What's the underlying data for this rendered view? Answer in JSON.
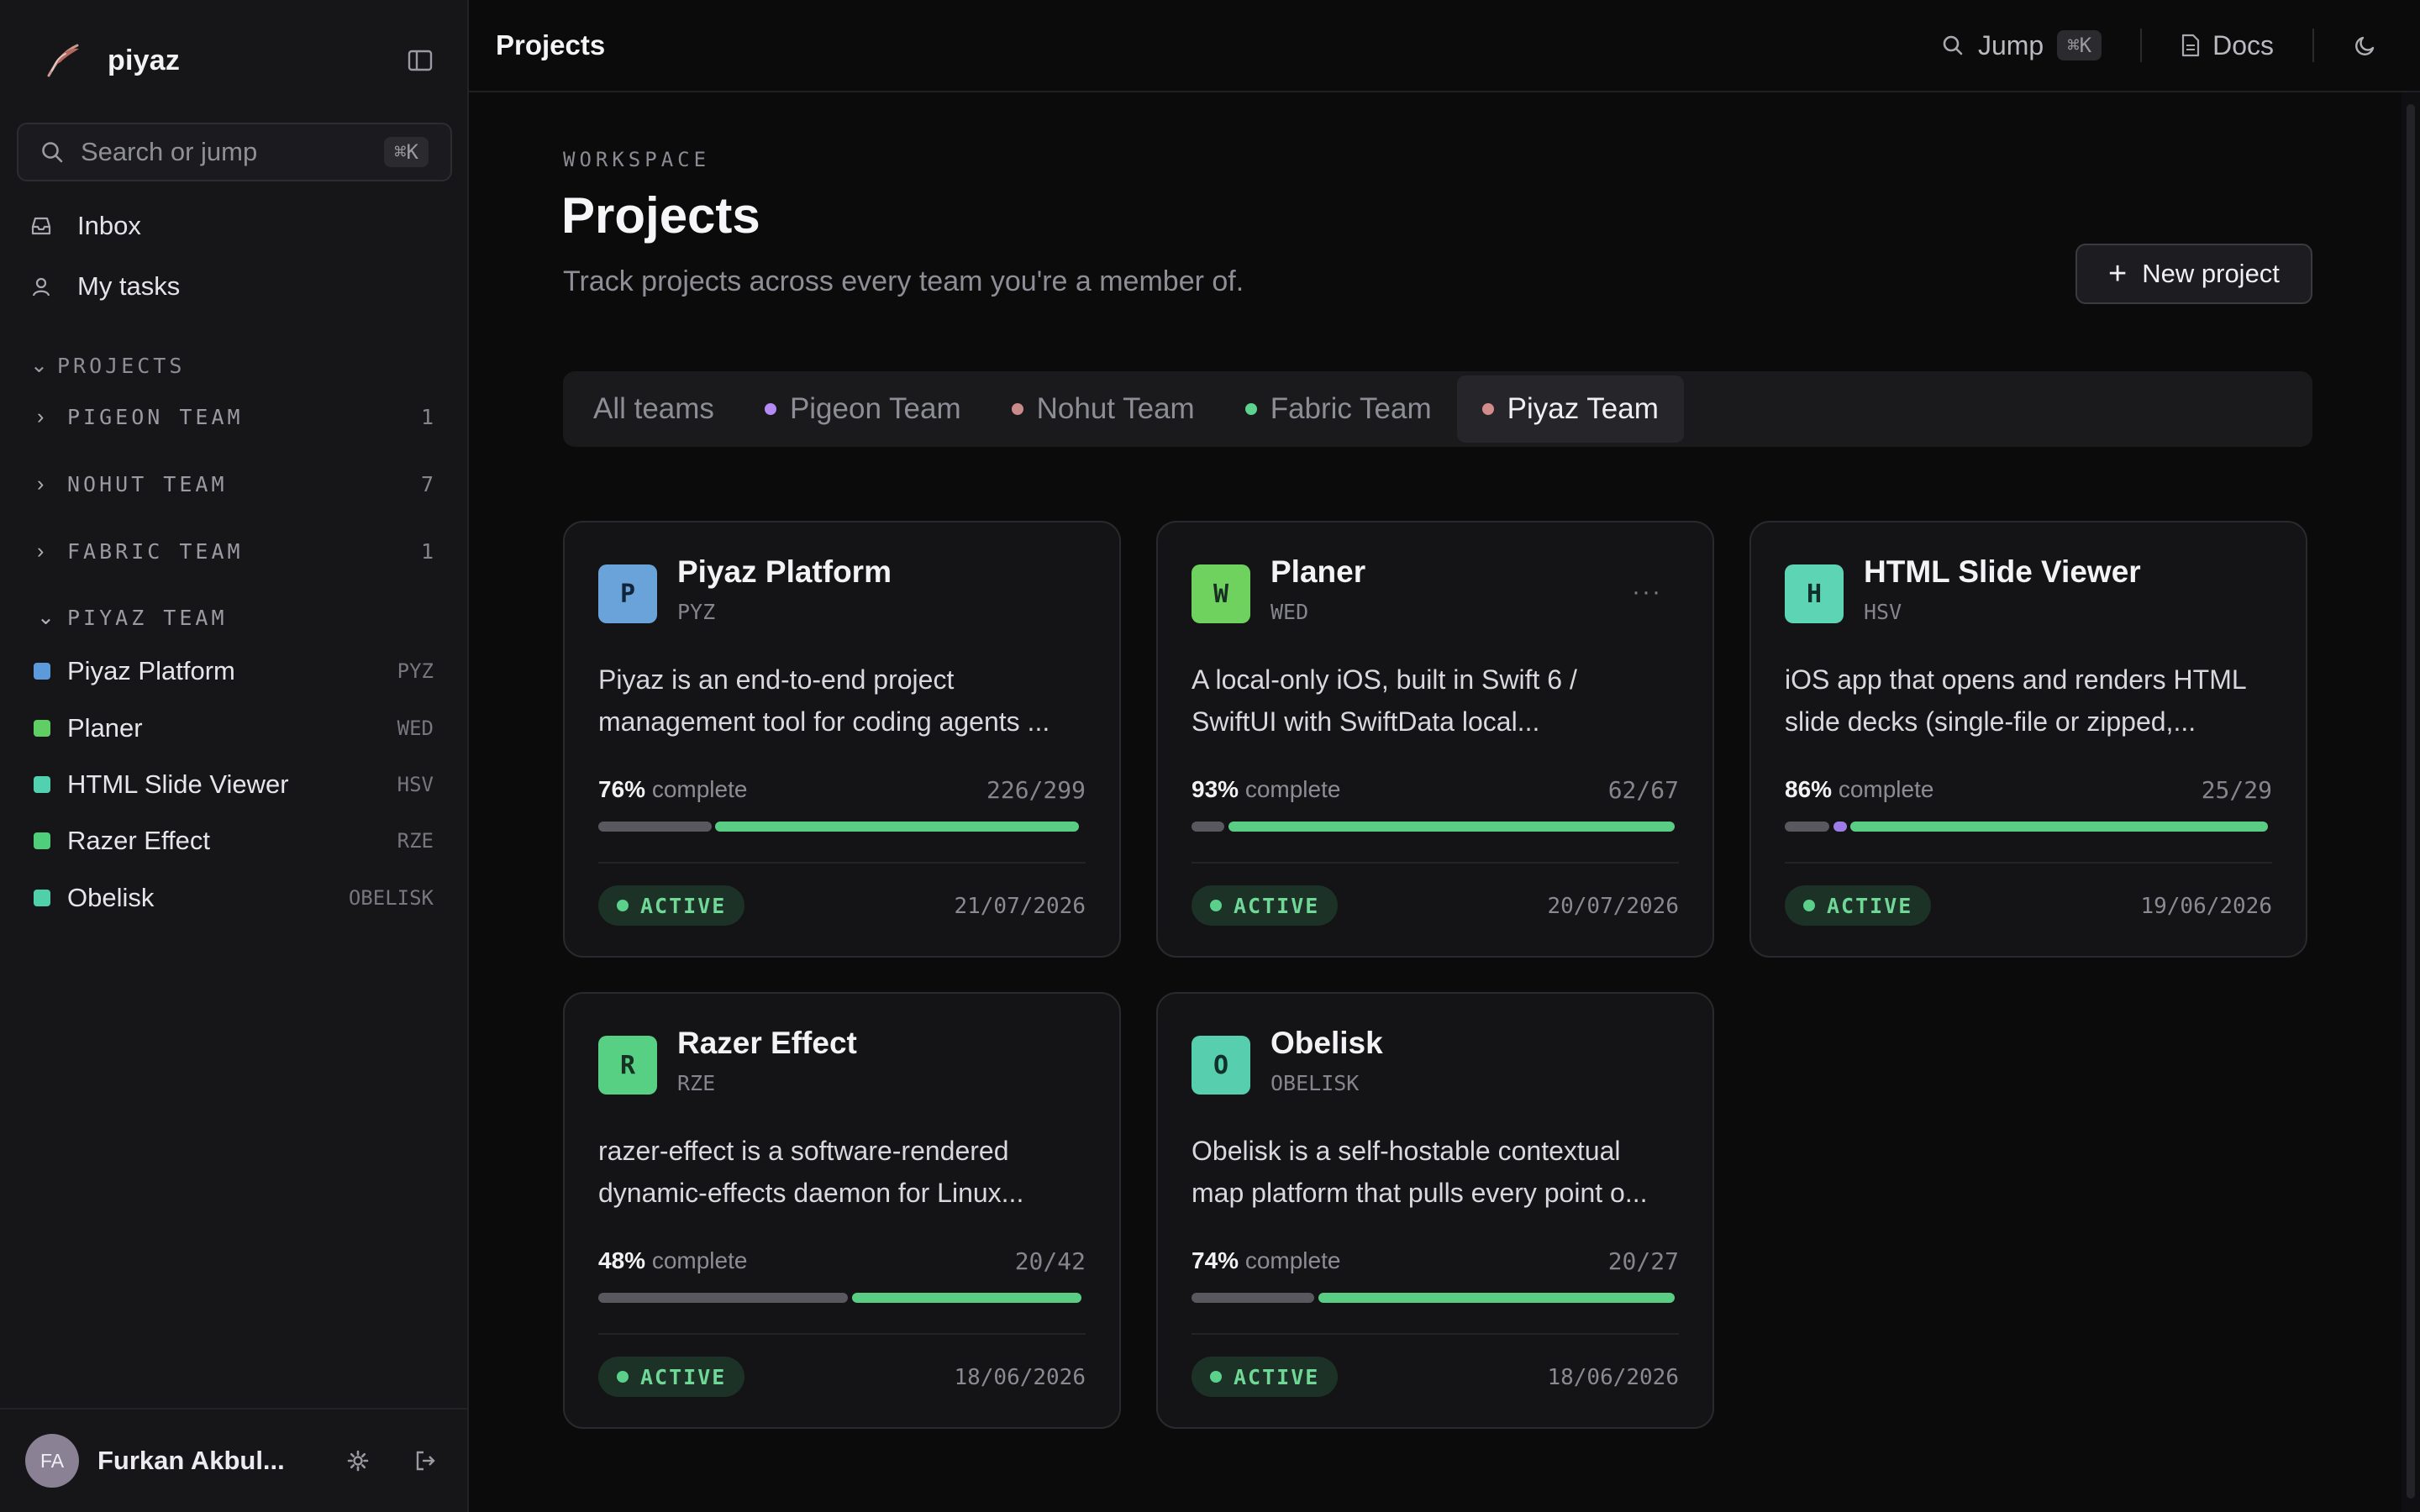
{
  "app": {
    "name": "piyaz"
  },
  "sidebar": {
    "search": {
      "placeholder": "Search or jump",
      "shortcut": "⌘K"
    },
    "nav": [
      {
        "label": "Inbox",
        "icon": "inbox-icon"
      },
      {
        "label": "My tasks",
        "icon": "user-icon"
      }
    ],
    "projects_heading": "PROJECTS",
    "teams": [
      {
        "name": "PIGEON TEAM",
        "count": "1",
        "expanded": false
      },
      {
        "name": "NOHUT TEAM",
        "count": "7",
        "expanded": false
      },
      {
        "name": "FABRIC TEAM",
        "count": "1",
        "expanded": false
      },
      {
        "name": "PIYAZ TEAM",
        "count": "",
        "expanded": true
      }
    ],
    "projects": [
      {
        "name": "Piyaz Platform",
        "code": "PYZ",
        "color": "#5b9bdc"
      },
      {
        "name": "Planer",
        "code": "WED",
        "color": "#5fce63"
      },
      {
        "name": "HTML Slide Viewer",
        "code": "HSV",
        "color": "#52d1b0"
      },
      {
        "name": "Razer Effect",
        "code": "RZE",
        "color": "#4fcf7c"
      },
      {
        "name": "Obelisk",
        "code": "OBELISK",
        "color": "#4fd0a8"
      }
    ],
    "user": {
      "initials": "FA",
      "name": "Furkan Akbul..."
    }
  },
  "topbar": {
    "title": "Projects",
    "jump_label": "Jump",
    "jump_shortcut": "⌘K",
    "docs_label": "Docs"
  },
  "main": {
    "eyebrow": "WORKSPACE",
    "title": "Projects",
    "subtitle": "Track projects across every team you're a member of.",
    "new_button": "New project",
    "tabs": [
      {
        "label": "All teams",
        "dot": "",
        "active": false
      },
      {
        "label": "Pigeon Team",
        "dot": "#b38bf2",
        "active": false
      },
      {
        "label": "Nohut Team",
        "dot": "#c98a8a",
        "active": false
      },
      {
        "label": "Fabric Team",
        "dot": "#5dd38f",
        "active": false
      },
      {
        "label": "Piyaz Team",
        "dot": "#d48b8b",
        "active": true
      }
    ],
    "complete_label": "complete",
    "cards": [
      {
        "letter": "P",
        "title": "Piyaz Platform",
        "code": "PYZ",
        "desc1": "Piyaz is an end-to-end project",
        "desc2": "management tool for coding agents ...",
        "percent": "76%",
        "count": "226/299",
        "status": "ACTIVE",
        "date": "21/07/2026",
        "badge_color": "#6aa3da",
        "more": false,
        "bar": {
          "gray": 0.24,
          "purple": 0.0,
          "green": 0.755
        }
      },
      {
        "letter": "W",
        "title": "Planer",
        "code": "WED",
        "desc1": "A local-only iOS, built in Swift 6 /",
        "desc2": "SwiftUI with SwiftData local...",
        "percent": "93%",
        "count": "62/67",
        "status": "ACTIVE",
        "date": "20/07/2026",
        "badge_color": "#6fd25e",
        "more": true,
        "bar": {
          "gray": 0.075,
          "purple": 0.0,
          "green": 0.925
        }
      },
      {
        "letter": "H",
        "title": "HTML Slide Viewer",
        "code": "HSV",
        "desc1": "iOS app that opens and renders HTML",
        "desc2": "slide decks (single-file or zipped,...",
        "percent": "86%",
        "count": "25/29",
        "status": "ACTIVE",
        "date": "19/06/2026",
        "badge_color": "#5dd4b4",
        "more": false,
        "bar": {
          "gray": 0.1,
          "purple": 0.035,
          "green": 0.865
        }
      },
      {
        "letter": "R",
        "title": "Razer Effect",
        "code": "RZE",
        "desc1": "razer-effect is a software-rendered",
        "desc2": "dynamic-effects daemon for Linux...",
        "percent": "48%",
        "count": "20/42",
        "status": "ACTIVE",
        "date": "18/06/2026",
        "badge_color": "#58d083",
        "more": false,
        "bar": {
          "gray": 0.52,
          "purple": 0.0,
          "green": 0.48
        }
      },
      {
        "letter": "O",
        "title": "Obelisk",
        "code": "OBELISK",
        "desc1": "Obelisk is a self-hostable contextual",
        "desc2": "map platform that pulls every point o...",
        "percent": "74%",
        "count": "20/27",
        "status": "ACTIVE",
        "date": "18/06/2026",
        "badge_color": "#57cfae",
        "more": false,
        "bar": {
          "gray": 0.26,
          "purple": 0.0,
          "green": 0.74
        }
      }
    ]
  }
}
